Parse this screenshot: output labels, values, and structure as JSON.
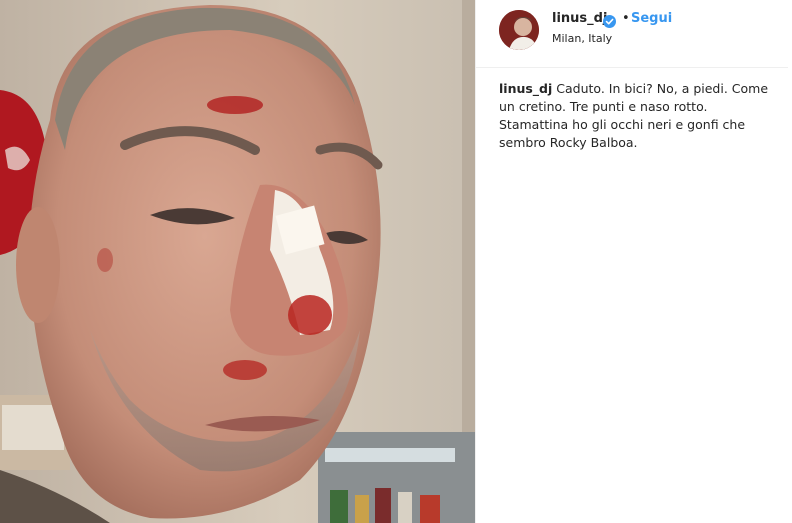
{
  "post": {
    "photo_icon": "selfie-photo",
    "username": "linus_dj",
    "verified_icon": "verified-badge-icon",
    "separator": "•",
    "follow_label": "Segui",
    "location": "Milan, Italy",
    "caption_user": "linus_dj",
    "caption_text": "Caduto. In bici? No, a piedi. Come un cretino. Tre punti e naso rotto. Stamattina ho gli occhi neri e gonfi che sembro Rocky Balboa."
  },
  "colors": {
    "follow": "#3897f0",
    "verified": "#3897f0",
    "text": "#262626"
  }
}
